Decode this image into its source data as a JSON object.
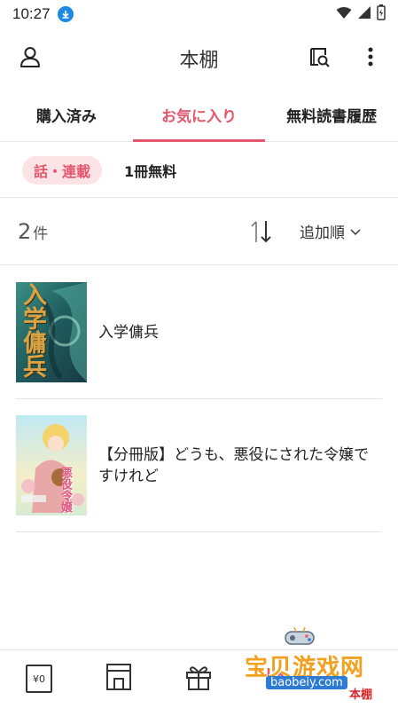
{
  "status_bar": {
    "time": "10:27"
  },
  "app_bar": {
    "title": "本棚"
  },
  "tabs": [
    {
      "label": "購入済み",
      "active": false
    },
    {
      "label": "お気に入り",
      "active": true
    },
    {
      "label": "無料読書履歴",
      "active": false
    }
  ],
  "filters": [
    {
      "label": "話・連載",
      "active": true
    },
    {
      "label": "1冊無料",
      "active": false
    }
  ],
  "count": {
    "value": "2",
    "unit": "件"
  },
  "sort": {
    "label": "追加順"
  },
  "items": [
    {
      "title": "入学傭兵",
      "cover_text": "入学傭兵"
    },
    {
      "title": "【分冊版】どうも、悪役にされた令嬢ですけれど",
      "cover_text": "悪役令嬢"
    }
  ],
  "bottom_nav": {
    "coin_label": "¥0"
  },
  "watermark": {
    "text": "宝贝游戏网",
    "url": "baobeiy.com",
    "badge": "本棚"
  },
  "colors": {
    "accent": "#e5576d",
    "chip_bg": "#fbe3e6",
    "divider": "#e6e6e6"
  }
}
